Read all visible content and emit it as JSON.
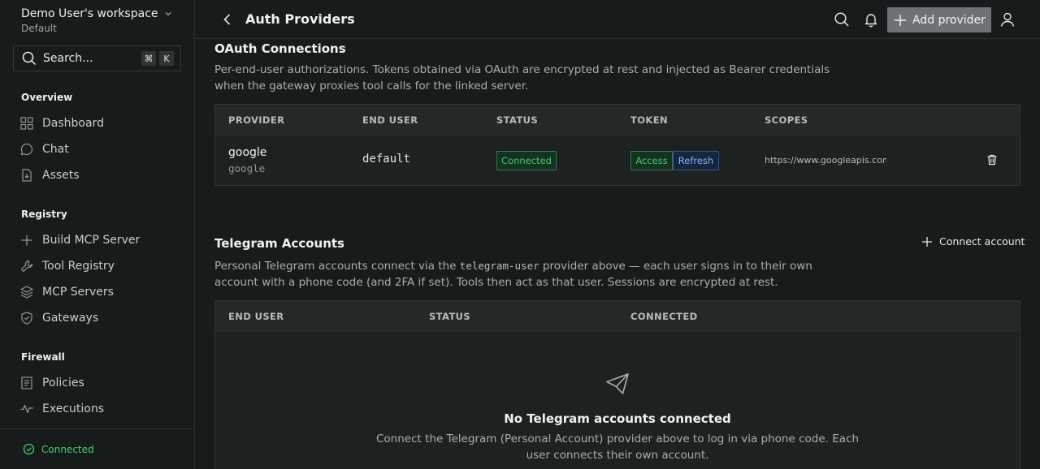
{
  "workspace": {
    "name": "Demo User's workspace",
    "plan": "Default"
  },
  "search": {
    "label": "Search...",
    "kbd1": "⌘",
    "kbd2": "K"
  },
  "sidebar": {
    "sections": [
      {
        "title": "Overview",
        "items": [
          "Dashboard",
          "Chat",
          "Assets"
        ]
      },
      {
        "title": "Registry",
        "items": [
          "Build MCP Server",
          "Tool Registry",
          "MCP Servers",
          "Gateways"
        ]
      },
      {
        "title": "Firewall",
        "items": [
          "Policies",
          "Executions"
        ]
      }
    ],
    "status": "Connected"
  },
  "header": {
    "title": "Auth Providers",
    "add_label": "Add provider"
  },
  "oauth": {
    "title": "OAuth Connections",
    "description": "Per-end-user authorizations. Tokens obtained via OAuth are encrypted at rest and injected as Bearer credentials when the gateway proxies tool calls for the linked server.",
    "columns": [
      "PROVIDER",
      "END USER",
      "STATUS",
      "TOKEN",
      "SCOPES"
    ],
    "rows": [
      {
        "provider": "google",
        "provider_id": "google",
        "end_user": "default",
        "status": "Connected",
        "token_access": "Access",
        "token_refresh": "Refresh",
        "scopes": "https://www.googleapis.com"
      }
    ]
  },
  "telegram": {
    "title": "Telegram Accounts",
    "connect_label": "Connect account",
    "desc_before": "Personal Telegram accounts connect via the ",
    "desc_code": "telegram-user",
    "desc_after": " provider above — each user signs in to their own account with a phone code (and 2FA if set). Tools then act as that user. Sessions are encrypted at rest.",
    "columns": [
      "END USER",
      "STATUS",
      "CONNECTED"
    ],
    "empty_title": "No Telegram accounts connected",
    "empty_desc": "Connect the Telegram (Personal Account) provider above to log in via phone code. Each user connects their own account."
  },
  "colors": {
    "accent_green": "#3fcf6c",
    "accent_blue": "#7fb6ff",
    "background": "#181b1b"
  }
}
